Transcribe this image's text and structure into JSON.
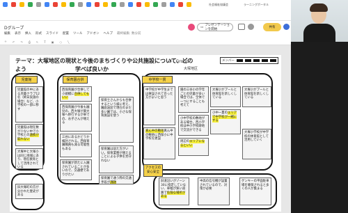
{
  "browser": {
    "tab_items": [
      "R",
      "R",
      "R",
      "R",
      "R",
      "R",
      "R",
      "R",
      "R",
      "R",
      "R",
      "R",
      "R",
      "R",
      "R",
      "R",
      "R",
      "R",
      "R",
      "R",
      "R",
      "R",
      "R"
    ],
    "right_links": [
      "社会福祉協議会",
      "ラーニングポータル"
    ]
  },
  "app": {
    "doc_title": "Dグループ",
    "menu": [
      "編集",
      "表示",
      "挿入",
      "形式",
      "スライド",
      "配置",
      "ツール",
      "アドオン",
      "ヘルプ",
      "最終編集: 数分前"
    ],
    "present_label": "プレゼンテーションを開始",
    "share_label": "共有",
    "colors": {
      "accent_yellow": "#f6d24a",
      "highlight": "#f6ef3a",
      "avatar_pink": "#e94a7b"
    }
  },
  "slide": {
    "theme_line1": "テーマ：大塚地区の現状と今後のまちづくりや公共施設について、どの",
    "theme_line2": "よう",
    "theme_line2b": "学べば良いか",
    "group": "D　Group",
    "district": "大塚地区",
    "member_label": "メンバー",
    "headers": {
      "jido": "児童館",
      "hoikuen": "保育園合併",
      "chugakko": "中学校一貫",
      "access": "アクセスの\n安心安全"
    },
    "notes": [
      {
        "id": "n1",
        "text": "児童館の中にある児童クラブ12名（終日実施の場合）など、小学校の一部に移す",
        "hl": ""
      },
      {
        "id": "n2",
        "text": "児童館は現在数が少ない中で小学校との",
        "hl": "連携が取れない"
      },
      {
        "id": "n3",
        "text": "西保育園が合併して小規模に",
        "hl": "合併してもいい"
      },
      {
        "id": "n4",
        "text": "西保育園が今後も園児の、西大塚が東大塚へ移行するが車での、お子さんが増える"
      },
      {
        "id": "n5",
        "text": "三谷にあるかどうか検討される。西保育園職員も減る可能性もある"
      },
      {
        "id": "n6",
        "text": "保育園が新たに入園されていることが多いので、交通便でありがたい"
      },
      {
        "id": "n7",
        "text": "保育士さんからも合併するという様に考え、園庭送迎で現在のまだ多い園では、小さな保育施設を使う"
      },
      {
        "id": "n8",
        "text": "保育園は居た方がいい。保育業務が増えることによる子供を見守れない"
      },
      {
        "id": "n9",
        "text": "保育園で通う際の交通手段が",
        "hl": "課題"
      },
      {
        "id": "n10",
        "text": "中学校が中学生までは併設されて合った方がよいと思う"
      },
      {
        "id": "n11",
        "text": "小中学校でも中学生まで学校という、地域のお互いとして助け合える、高齢者との関係ができる"
      },
      {
        "id": "n12",
        "text": "真ん中の敷地に西保小に中学校を建設",
        "hl": "真ん中の敷地"
      },
      {
        "id": "n13",
        "text": "陽の三谷小の学年ごとの児童が多い場合では、全体で一つにすることも考えて"
      },
      {
        "id": "n14",
        "text": "小中学校の敷地がある場合、西小学校は中小学校跡地で交流ができる"
      },
      {
        "id": "n15",
        "text": "中学校を建設していく中で、大塚の生徒も持ち寄って小学校にしていく"
      },
      {
        "id": "n16",
        "text": "大塚小がプールと体育館を新しくしている"
      },
      {
        "id": "n17",
        "text": "小中一貫の",
        "hl": "エリアで中学校が一緒にする"
      },
      {
        "id": "n18",
        "text": "周辺の",
        "hl": "エリアになるといい"
      },
      {
        "id": "n19",
        "text": "大塚小学校が中学校の体育館として活用していく"
      },
      {
        "id": "n20",
        "text": "大塚中と大塚小は同じ地域にあり、現在教育として活用されている"
      },
      {
        "id": "n21",
        "text": "旧大塚町の方が分かれた歴史がある"
      },
      {
        "id": "n22",
        "text": "旧道沿いがゾーン30に指定していない、車幅が狭い道路で",
        "hl": "危険な場所がある"
      },
      {
        "id": "n23",
        "text": "中高の信号機が設置されているので、対策が必要"
      },
      {
        "id": "n24",
        "text": "ゲンキーの平面駐車場を確保されると多くの人が集まる"
      }
    ]
  }
}
